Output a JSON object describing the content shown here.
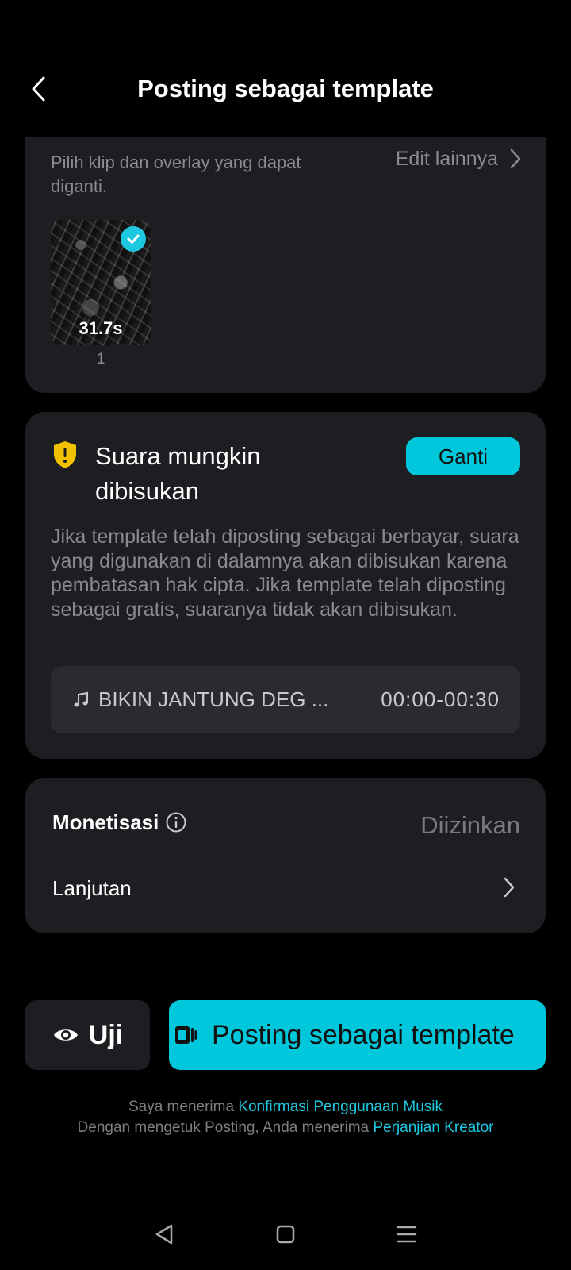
{
  "header": {
    "title": "Posting sebagai template",
    "back_icon": "chevron-left-icon"
  },
  "clips_card": {
    "description": "Pilih klip dan overlay yang dapat diganti.",
    "edit_more_label": "Edit lainnya",
    "clips": [
      {
        "duration": "31.7s",
        "index": "1",
        "selected": true
      }
    ]
  },
  "sound_card": {
    "title": "Suara mungkin dibisukan",
    "change_button": "Ganti",
    "description": "Jika template telah diposting sebagai berbayar, suara yang digunakan di dalamnya akan dibisukan karena pembatasan hak cipta. Jika template telah diposting sebagai gratis, suaranya tidak akan dibisukan.",
    "music_name": "BIKIN JANTUNG DEG ...",
    "music_time": "00:00-00:30",
    "warning_color": "#f2c200"
  },
  "monetization_card": {
    "label": "Monetisasi",
    "value": "Diizinkan",
    "advanced_label": "Lanjutan"
  },
  "actions": {
    "test_label": "Uji",
    "post_label": "Posting sebagai template"
  },
  "footer": {
    "line1_prefix": "Saya menerima",
    "line1_link": "Konfirmasi Penggunaan Musik",
    "line2_prefix": "Dengan mengetuk Posting, Anda menerima",
    "line2_link": "Perjanjian Kreator"
  },
  "colors": {
    "accent": "#00c8dc",
    "card_bg": "#1d1e22",
    "background": "#000000"
  }
}
